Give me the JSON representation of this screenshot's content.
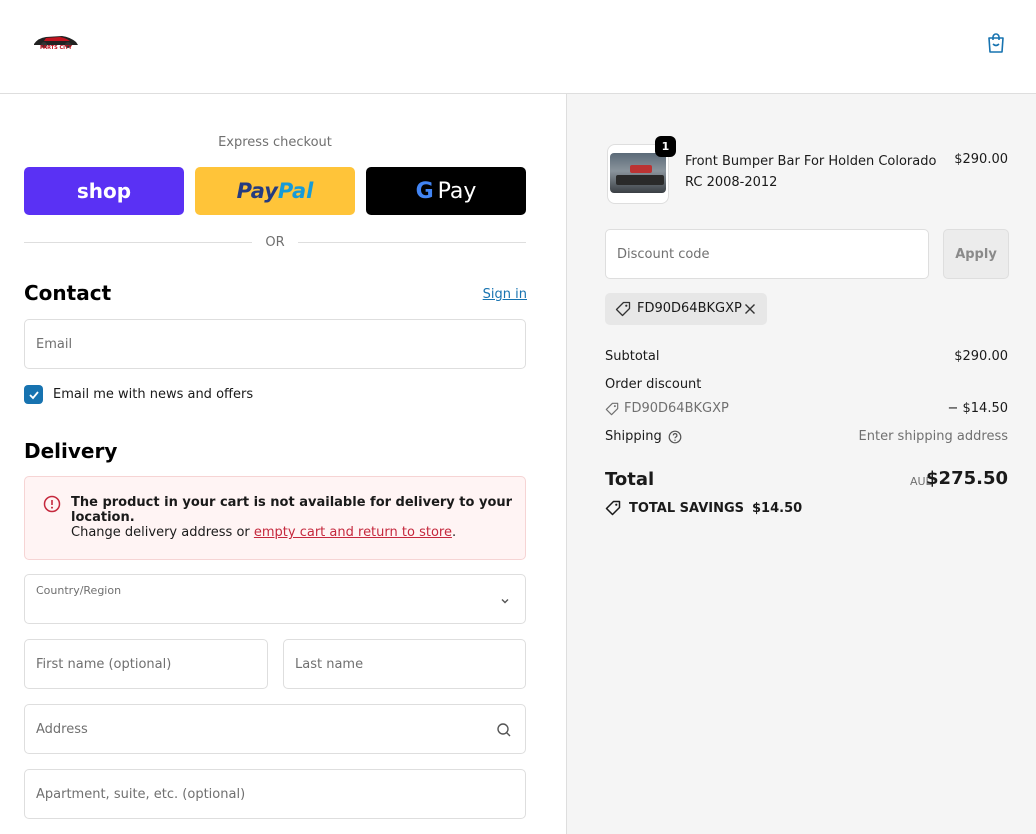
{
  "header": {
    "logo_text": "PARTS CITY"
  },
  "express": {
    "label": "Express checkout",
    "shop_label": "shop",
    "paypal_part1": "Pay",
    "paypal_part2": "Pal",
    "gpay_g": "G",
    "gpay_label": "Pay",
    "divider": "OR"
  },
  "contact": {
    "title": "Contact",
    "sign_in": "Sign in",
    "email_placeholder": "Email",
    "newsletter_label": "Email me with news and offers",
    "newsletter_checked": true
  },
  "delivery": {
    "title": "Delivery",
    "alert_title": "The product in your cart is not available for delivery to your location.",
    "alert_body_prefix": "Change delivery address or ",
    "alert_link": "empty cart and return to store",
    "alert_body_suffix": ".",
    "country_label": "Country/Region",
    "first_name_placeholder": "First name (optional)",
    "last_name_placeholder": "Last name",
    "address_placeholder": "Address",
    "apartment_placeholder": "Apartment, suite, etc. (optional)"
  },
  "summary": {
    "product": {
      "name": "Front Bumper Bar For Holden Colorado RC 2008-2012",
      "price": "$290.00",
      "quantity": "1"
    },
    "discount_placeholder": "Discount code",
    "apply_label": "Apply",
    "applied_code": "FD90D64BKGXP",
    "subtotal_label": "Subtotal",
    "subtotal_value": "$290.00",
    "order_discount_label": "Order discount",
    "order_discount_code": "FD90D64BKGXP",
    "order_discount_value": "− $14.50",
    "shipping_label": "Shipping",
    "shipping_value": "Enter shipping address",
    "total_label": "Total",
    "total_currency": "AUD",
    "total_value": "$275.50",
    "savings_label": "TOTAL SAVINGS",
    "savings_value": "$14.50"
  },
  "colors": {
    "accent": "#1773b0",
    "shop": "#5a31f4",
    "paypal": "#ffc439",
    "error": "#c5283d"
  }
}
